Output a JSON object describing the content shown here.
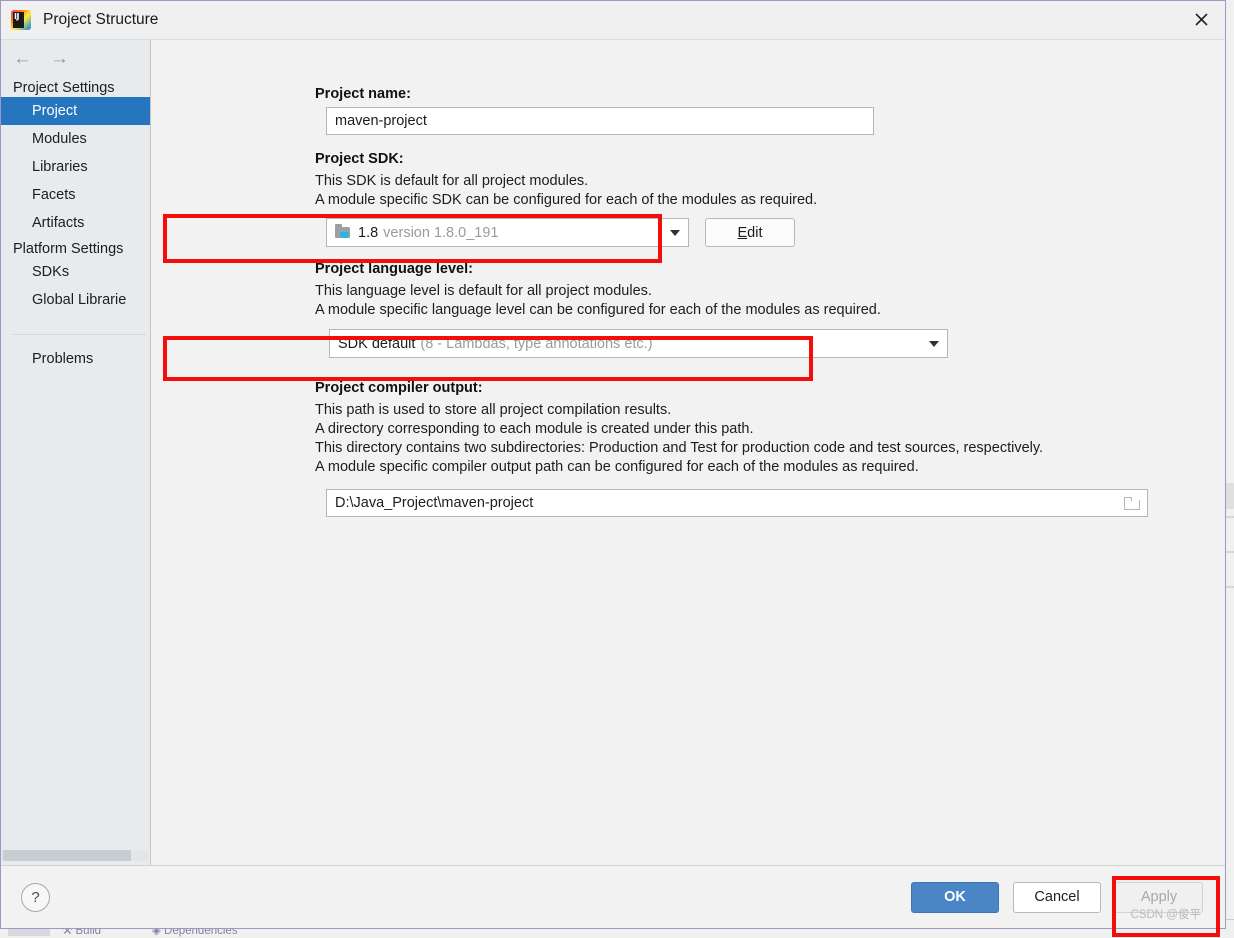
{
  "window": {
    "title": "Project Structure",
    "logo_icon": "intellij-idea-logo",
    "logo_text": "IJ",
    "close_icon": "close-icon"
  },
  "sidebar": {
    "back_icon": "arrow-left-icon",
    "forward_icon": "arrow-right-icon",
    "groups": [
      {
        "label": "Project Settings",
        "items": [
          {
            "label": "Project",
            "selected": true
          },
          {
            "label": "Modules",
            "selected": false
          },
          {
            "label": "Libraries",
            "selected": false
          },
          {
            "label": "Facets",
            "selected": false
          },
          {
            "label": "Artifacts",
            "selected": false
          }
        ]
      },
      {
        "label": "Platform Settings",
        "items": [
          {
            "label": "SDKs",
            "selected": false
          },
          {
            "label": "Global Librarie",
            "selected": false
          }
        ]
      }
    ],
    "extra_items": [
      {
        "label": "Problems",
        "selected": false
      }
    ]
  },
  "main": {
    "project_name": {
      "label": "Project name:",
      "value": "maven-project",
      "placeholder": ""
    },
    "project_sdk": {
      "label": "Project SDK:",
      "desc_line1": "This SDK is default for all project modules.",
      "desc_line2": "A module specific SDK can be configured for each of the modules as required.",
      "icon": "java-sdk-folder-icon",
      "value_name": "1.8",
      "value_version": "version 1.8.0_191",
      "dropdown_icon": "chevron-down-icon",
      "edit_button": "Edit",
      "edit_mnemonic": "E",
      "edit_rest": "dit"
    },
    "language_level": {
      "label": "Project language level:",
      "desc_line1": "This language level is default for all project modules.",
      "desc_line2": "A module specific language level can be configured for each of the modules as required.",
      "value_name": "SDK default",
      "value_detail": "(8 - Lambdas, type annotations etc.)",
      "dropdown_icon": "chevron-down-icon"
    },
    "compiler_output": {
      "label": "Project compiler output:",
      "desc_line1": "This path is used to store all project compilation results.",
      "desc_line2": "A directory corresponding to each module is created under this path.",
      "desc_line3": "This directory contains two subdirectories: Production and Test for production code and test sources, respectively.",
      "desc_line4": "A module specific compiler output path can be configured for each of the modules as required.",
      "value": "D:\\Java_Project\\maven-project",
      "browse_icon": "folder-browse-icon"
    }
  },
  "footer": {
    "help_label": "?",
    "help_icon": "help-icon",
    "ok_label": "OK",
    "cancel_label": "Cancel",
    "apply_label": "Apply",
    "watermark": "CSDN @俊平"
  },
  "annotations": {
    "highlight_color": "#f40d0d",
    "boxes": [
      {
        "name": "sdk-row-highlight"
      },
      {
        "name": "language-level-highlight"
      },
      {
        "name": "apply-button-highlight"
      }
    ]
  },
  "theme": {
    "selection_blue": "#2675bf",
    "ok_button_blue": "#4a86c5",
    "dialog_bg": "#f2f2f2",
    "sidebar_bg": "#e7ebee"
  }
}
